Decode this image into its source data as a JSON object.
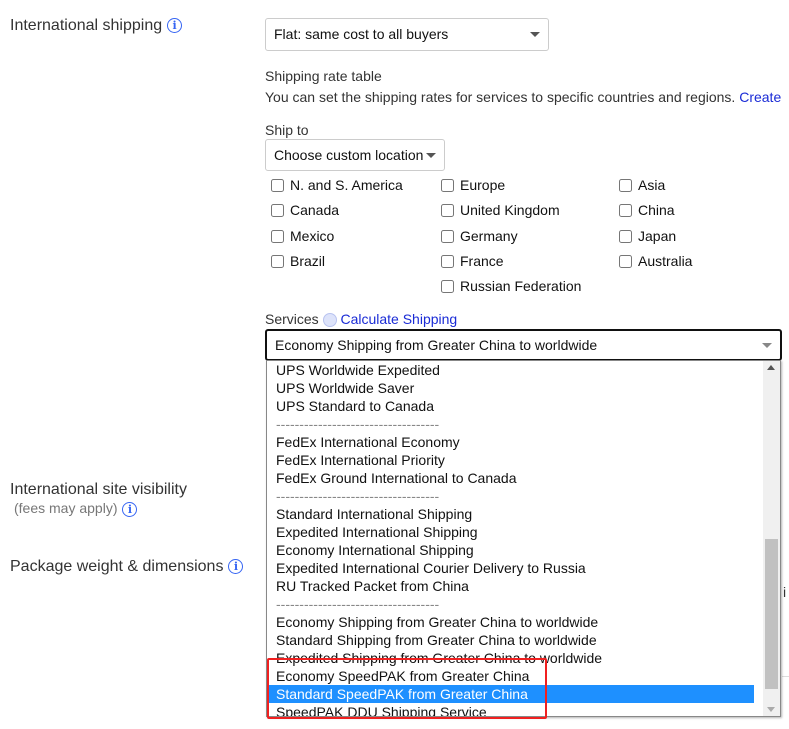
{
  "international_shipping": {
    "label": "International shipping",
    "selected": "Flat: same cost to all buyers"
  },
  "rate_table": {
    "title": "Shipping rate table",
    "description": "You can set the shipping rates for services to specific countries and regions.",
    "create_link": "Create"
  },
  "ship_to": {
    "label": "Ship to",
    "selected": "Choose custom location",
    "locations": [
      {
        "label": "N. and S. America",
        "checked": false
      },
      {
        "label": "Canada",
        "checked": false
      },
      {
        "label": "Mexico",
        "checked": false
      },
      {
        "label": "Brazil",
        "checked": false
      },
      {
        "label": "Europe",
        "checked": false
      },
      {
        "label": "United Kingdom",
        "checked": false
      },
      {
        "label": "Germany",
        "checked": false
      },
      {
        "label": "France",
        "checked": false
      },
      {
        "label": "Russian Federation",
        "checked": false
      },
      {
        "label": "Asia",
        "checked": false
      },
      {
        "label": "China",
        "checked": false
      },
      {
        "label": "Japan",
        "checked": false
      },
      {
        "label": "Australia",
        "checked": false
      }
    ]
  },
  "services": {
    "label": "Services",
    "calculate_link": "Calculate Shipping",
    "selected": "Economy Shipping from Greater China to worldwide",
    "options": [
      "UPS Worldwide Expedited",
      "UPS Worldwide Saver",
      "UPS Standard to Canada",
      "-----------------------------------",
      "FedEx International Economy",
      "FedEx International Priority",
      "FedEx Ground International to Canada",
      "-----------------------------------",
      "Standard International Shipping",
      "Expedited International Shipping",
      "Economy International Shipping",
      "Expedited International Courier Delivery to Russia",
      "RU Tracked Packet from China",
      "-----------------------------------",
      "Economy Shipping from Greater China to worldwide",
      "Standard Shipping from Greater China to worldwide",
      "Expedited Shipping from Greater China to worldwide",
      "Economy SpeedPAK from Greater China",
      "Standard SpeedPAK from Greater China",
      "SpeedPAK DDU Shipping Service"
    ],
    "highlighted": "Standard SpeedPAK from Greater China"
  },
  "site_visibility": {
    "label": "International site visibility",
    "note": "(fees may apply)"
  },
  "package": {
    "label": "Package weight & dimensions"
  },
  "colors": {
    "accent": "#3665f3",
    "highlight": "#1e90ff",
    "annotation": "#f02020"
  }
}
